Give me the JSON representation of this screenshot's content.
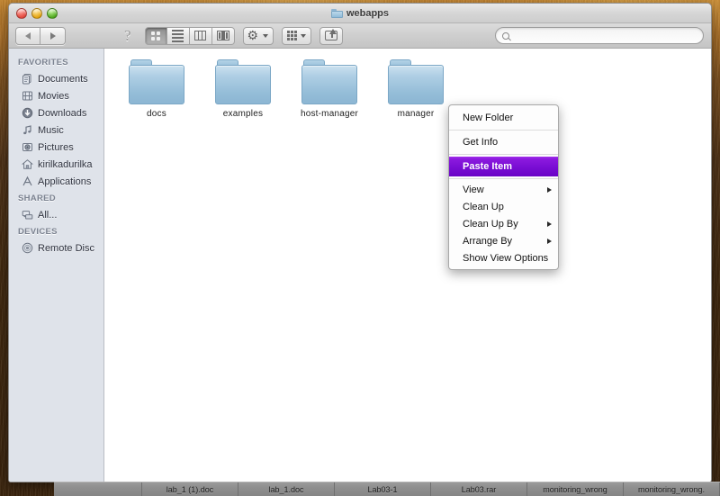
{
  "desktop": {
    "wallpaper_name": "fur-wallpaper"
  },
  "window": {
    "title": "webapps",
    "title_icon": "folder-icon",
    "controls": {
      "close_label": "close",
      "minimize_label": "minimize",
      "zoom_label": "zoom"
    }
  },
  "toolbar": {
    "back_label": "back",
    "forward_label": "forward",
    "help_glyph": "?",
    "view_modes": [
      {
        "name": "icon-view",
        "label": "Icon View",
        "active": true
      },
      {
        "name": "list-view",
        "label": "List View",
        "active": false
      },
      {
        "name": "column-view",
        "label": "Column View",
        "active": false
      },
      {
        "name": "coverflow-view",
        "label": "Cover Flow View",
        "active": false
      }
    ],
    "action_menu_label": "Action",
    "arrange_menu_label": "Arrange",
    "share_label": "Share"
  },
  "search": {
    "value": "",
    "placeholder": "",
    "icon": "search-icon"
  },
  "sidebar": {
    "sections": [
      {
        "heading": "FAVORITES",
        "items": [
          {
            "label": "Documents",
            "icon": "documents-icon"
          },
          {
            "label": "Movies",
            "icon": "movies-icon"
          },
          {
            "label": "Downloads",
            "icon": "downloads-icon"
          },
          {
            "label": "Music",
            "icon": "music-icon"
          },
          {
            "label": "Pictures",
            "icon": "pictures-icon"
          },
          {
            "label": "kirilkadurilka",
            "icon": "home-icon"
          },
          {
            "label": "Applications",
            "icon": "applications-icon"
          }
        ]
      },
      {
        "heading": "SHARED",
        "items": [
          {
            "label": "All...",
            "icon": "network-icon"
          }
        ]
      },
      {
        "heading": "DEVICES",
        "items": [
          {
            "label": "Remote Disc",
            "icon": "disc-icon"
          }
        ]
      }
    ]
  },
  "main": {
    "files": [
      {
        "name": "docs",
        "icon": "folder-icon"
      },
      {
        "name": "examples",
        "icon": "folder-icon"
      },
      {
        "name": "host-manager",
        "icon": "folder-icon"
      },
      {
        "name": "manager",
        "icon": "folder-icon"
      }
    ]
  },
  "context_menu": {
    "highlight_color": "#7a0ed4",
    "items": [
      {
        "label": "New Folder",
        "submenu": false,
        "highlighted": false,
        "separator_after": true
      },
      {
        "label": "Get Info",
        "submenu": false,
        "highlighted": false,
        "separator_after": true
      },
      {
        "label": "Paste Item",
        "submenu": false,
        "highlighted": true,
        "separator_after": true
      },
      {
        "label": "View",
        "submenu": true,
        "highlighted": false,
        "separator_after": false
      },
      {
        "label": "Clean Up",
        "submenu": false,
        "highlighted": false,
        "separator_after": false
      },
      {
        "label": "Clean Up By",
        "submenu": true,
        "highlighted": false,
        "separator_after": false
      },
      {
        "label": "Arrange By",
        "submenu": true,
        "highlighted": false,
        "separator_after": false
      },
      {
        "label": "Show View Options",
        "submenu": false,
        "highlighted": false,
        "separator_after": false
      }
    ]
  },
  "taskbar": {
    "items": [
      {
        "label": "lab_1 (1).doc"
      },
      {
        "label": "lab_1.doc"
      },
      {
        "label": "Lab03-1"
      },
      {
        "label": "Lab03.rar"
      },
      {
        "label": "monitoring_wrong"
      },
      {
        "label": "monitoring_wrong."
      }
    ]
  }
}
